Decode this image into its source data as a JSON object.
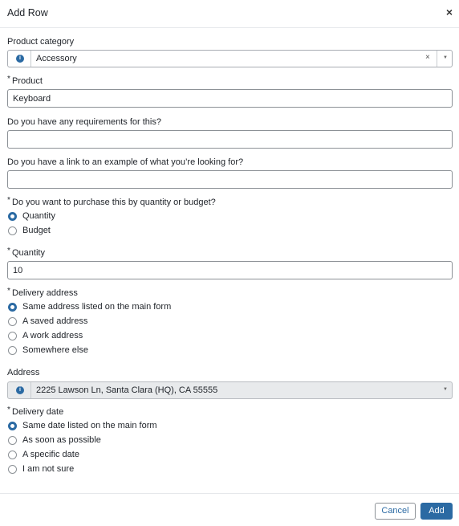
{
  "dialog": {
    "title": "Add Row",
    "close_symbol": "×"
  },
  "product_category": {
    "label": "Product category",
    "value": "Accessory",
    "info_icon": "info-icon",
    "clear_symbol": "×",
    "arrow_symbol": "▼"
  },
  "product": {
    "required_mark": "*",
    "label": "Product",
    "value": "Keyboard"
  },
  "requirements": {
    "label": "Do you have any requirements for this?",
    "value": ""
  },
  "example_link": {
    "label": "Do you have a link to an example of what you’re looking for?",
    "value": ""
  },
  "purchase_by": {
    "required_mark": "*",
    "label": "Do you want to purchase this by quantity or budget?",
    "options": [
      "Quantity",
      "Budget"
    ],
    "selected": "Quantity"
  },
  "quantity": {
    "required_mark": "*",
    "label": "Quantity",
    "value": "10"
  },
  "delivery_address": {
    "required_mark": "*",
    "label": "Delivery address",
    "options": [
      "Same address listed on the main form",
      "A saved address",
      "A work address",
      "Somewhere else"
    ],
    "selected": "Same address listed on the main form"
  },
  "address": {
    "label": "Address",
    "value": "2225 Lawson Ln, Santa Clara (HQ), CA 55555",
    "info_icon": "info-icon",
    "arrow_symbol": "▼"
  },
  "delivery_date": {
    "required_mark": "*",
    "label": "Delivery date",
    "options": [
      "Same date listed on the main form",
      "As soon as possible",
      "A specific date",
      "I am not sure"
    ],
    "selected": "Same date listed on the main form"
  },
  "footer": {
    "cancel_label": "Cancel",
    "add_label": "Add"
  },
  "colors": {
    "accent": "#2b6aa3",
    "border": "#8c9196",
    "disabled_bg": "#e8eaec"
  }
}
